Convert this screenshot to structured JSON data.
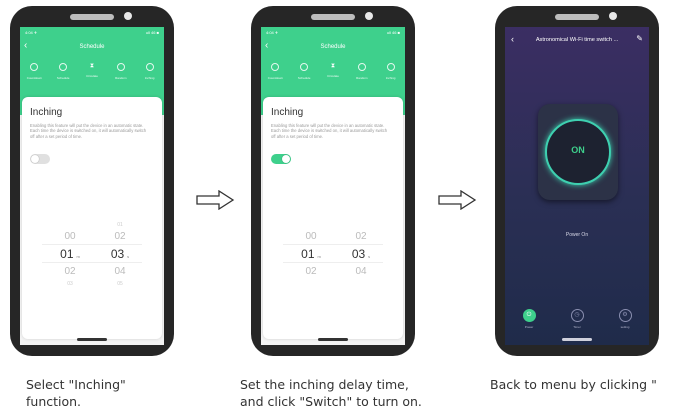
{
  "phone1": {
    "status_left": "4:04 ✈",
    "status_right": "ull 46 ■",
    "header_title": "Schedule",
    "tabs": [
      "Countdown",
      "Schedule",
      "Circulate",
      "Random",
      "Inching"
    ],
    "card_title": "Inching",
    "card_desc": "Enabling this feature will put the device in an automatic state. Each time the device is switched on, it will automatically switch off after a set period of time.",
    "picker_min": [
      "00",
      "01",
      "02",
      "03"
    ],
    "picker_min_unit": "m",
    "picker_sec": [
      "01",
      "02",
      "03",
      "04",
      "05"
    ],
    "picker_sec_unit": "s"
  },
  "phone2": {
    "status_left": "4:04 ✈",
    "status_right": "ull 46 ■",
    "header_title": "Schedule",
    "tabs": [
      "Countdown",
      "Schedule",
      "Circulate",
      "Random",
      "Inching"
    ],
    "card_title": "Inching",
    "card_desc": "Enabling this feature will put the device in an automatic state. Each time the device is switched on, it will automatically switch off after a set period of time.",
    "picker_min": [
      "00",
      "01",
      "02"
    ],
    "picker_min_unit": "m",
    "picker_sec": [
      "02",
      "03",
      "04"
    ],
    "picker_sec_unit": "s"
  },
  "phone3": {
    "title": "Astronomical Wi-Fi time switch ...",
    "on_label": "ON",
    "power_state": "Power On",
    "nav": [
      "Power",
      "Timer",
      "setting"
    ]
  },
  "captions": {
    "c1": [
      "Select \"Inching\"",
      "function."
    ],
    "c2": [
      "Set the inching delay time,",
      "and click \"Switch\" to turn on."
    ],
    "c3": [
      "Back to menu by clicking \""
    ]
  },
  "colors": {
    "accent": "#3ed08c",
    "dark_bg": "#2a2f54"
  }
}
